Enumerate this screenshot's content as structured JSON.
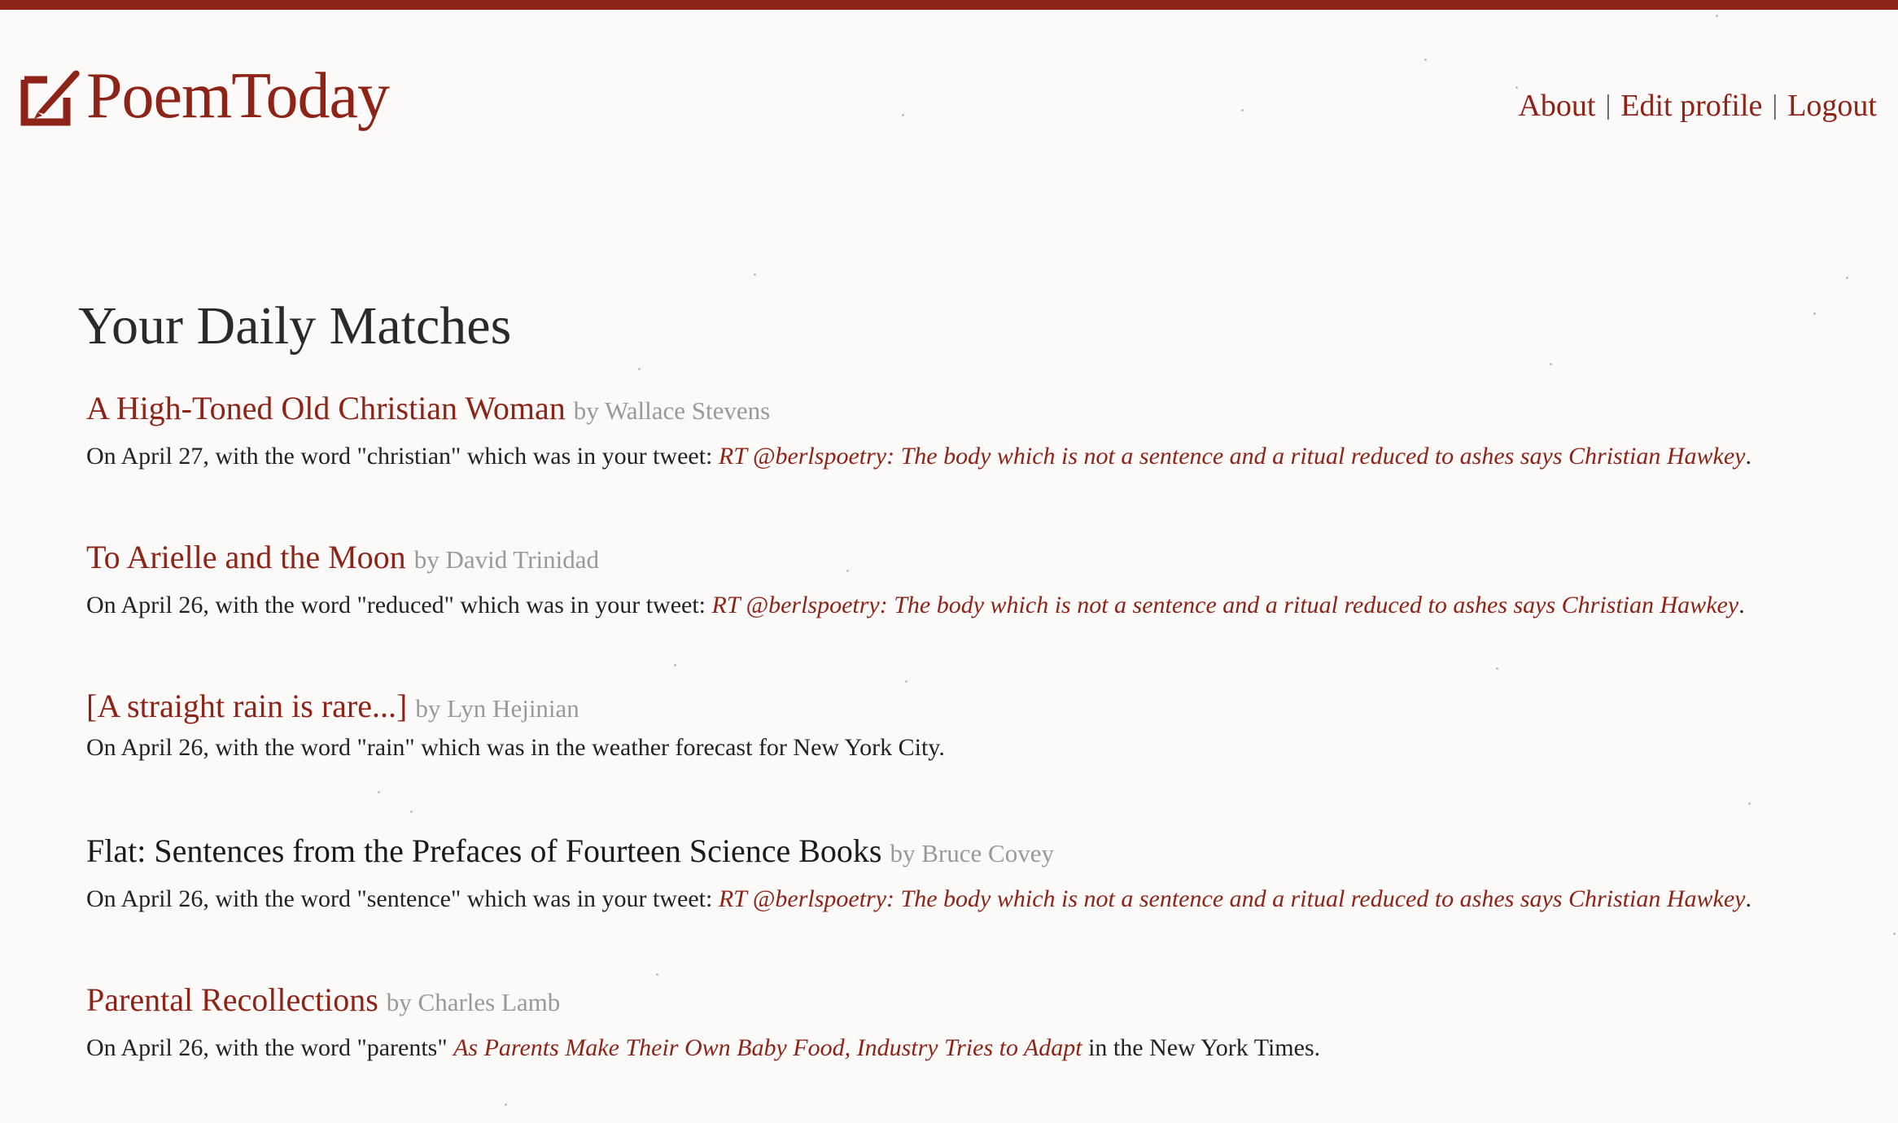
{
  "site": {
    "name": "PoemToday",
    "brand_color": "#8e2317",
    "logo_icon": "quill-pen-icon"
  },
  "nav": {
    "about": "About",
    "edit_profile": "Edit profile",
    "logout": "Logout",
    "separator": "|"
  },
  "page": {
    "title": "Your Daily Matches"
  },
  "matches": [
    {
      "title": "A High-Toned Old Christian Woman",
      "by": "by Wallace Stevens",
      "desc_before": "On April 27, with the word \"christian\" which was in your tweet: ",
      "ref": "RT @berlspoetry: The body which is not a sentence and a ritual reduced to ashes says Christian Hawkey",
      "desc_after": "."
    },
    {
      "title": "To Arielle and the Moon",
      "by": "by David Trinidad",
      "desc_before": "On April 26, with the word \"reduced\" which was in your tweet: ",
      "ref": "RT @berlspoetry: The body which is not a sentence and a ritual reduced to ashes says Christian Hawkey",
      "desc_after": "."
    },
    {
      "title": "[A straight rain is rare...]",
      "by": "by Lyn Hejinian",
      "desc_before": "On April 26, with the word \"rain\" which was in the weather forecast for New York City.",
      "ref": "",
      "desc_after": ""
    },
    {
      "title": "Flat: Sentences from the Prefaces of Fourteen Science Books",
      "by": "by Bruce Covey",
      "desc_before": "On April 26, with the word \"sentence\" which was in your tweet: ",
      "ref": "RT @berlspoetry: The body which is not a sentence and a ritual reduced to ashes says Christian Hawkey",
      "desc_after": "."
    },
    {
      "title": "Parental Recollections",
      "by": "by Charles Lamb",
      "desc_before": "On April 26, with the word \"parents\" ",
      "ref": "As Parents Make Their Own Baby Food, Industry Tries to Adapt",
      "desc_after": " in the New York Times."
    }
  ]
}
